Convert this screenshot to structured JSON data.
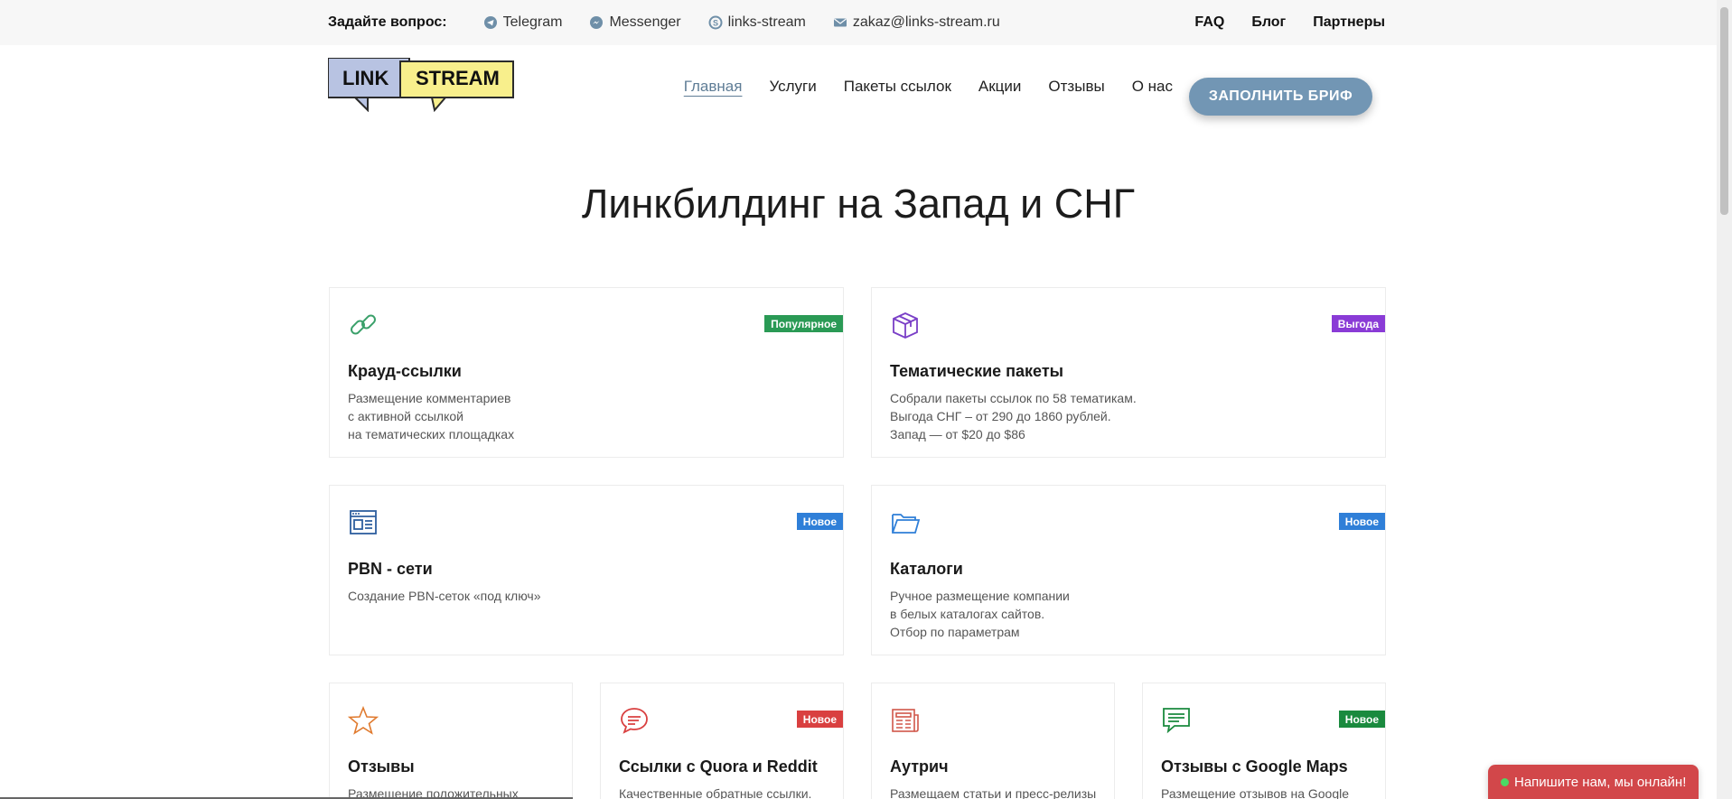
{
  "topbar": {
    "ask_label": "Задайте вопрос:",
    "contacts": [
      {
        "icon": "telegram-icon",
        "label": "Telegram"
      },
      {
        "icon": "messenger-icon",
        "label": "Messenger"
      },
      {
        "icon": "skype-icon",
        "label": "links-stream"
      },
      {
        "icon": "mail-icon",
        "label": "zakaz@links-stream.ru"
      }
    ],
    "links": [
      "FAQ",
      "Блог",
      "Партнеры"
    ]
  },
  "logo": {
    "left": "LINK",
    "right": "STREAM"
  },
  "nav": {
    "items": [
      "Главная",
      "Услуги",
      "Пакеты ссылок",
      "Акции",
      "Отзывы",
      "О нас"
    ],
    "active": "Главная",
    "cta": "ЗАПОЛНИТЬ БРИФ"
  },
  "hero": {
    "title": "Линкбилдинг на Запад и СНГ"
  },
  "cards": [
    {
      "icon": "chain-link-icon",
      "badge": "Популярное",
      "badge_color": "#2a9a55",
      "title": "Крауд-ссылки",
      "desc": [
        "Размещение комментариев",
        "с активной ссылкой",
        "на тематических площадках"
      ]
    },
    {
      "icon": "box-icon",
      "badge": "Выгода",
      "badge_color": "#8a3bd6",
      "title": "Тематические пакеты",
      "desc": [
        "Собрали пакеты ссылок по 58 тематикам.",
        "Выгода СНГ – от 290 до 1860 рублей.",
        "Запад — от $20 до $86"
      ]
    },
    {
      "icon": "website-icon",
      "badge": "Новое",
      "badge_color": "#2f7fd8",
      "title": "PBN - сети",
      "desc": [
        "Создание PBN-сеток «под ключ»"
      ]
    },
    {
      "icon": "folder-icon",
      "badge": "Новое",
      "badge_color": "#2f7fd8",
      "title": "Каталоги",
      "desc": [
        "Ручное размещение компании",
        "в белых каталогах сайтов.",
        "Отбор по параметрам"
      ]
    },
    {
      "icon": "star-icon",
      "badge": "",
      "badge_color": "",
      "title": "Отзывы",
      "desc": [
        "Размещение положительных"
      ]
    },
    {
      "icon": "speech-bubble-icon",
      "badge": "Новое",
      "badge_color": "#d94040",
      "title": "Ссылки с Quora и Reddit",
      "desc": [
        "Качественные обратные ссылки."
      ]
    },
    {
      "icon": "newspaper-icon",
      "badge": "",
      "badge_color": "",
      "title": "Аутрич",
      "desc": [
        "Размещаем статьи и пресс-релизы"
      ]
    },
    {
      "icon": "chat-icon",
      "badge": "Новое",
      "badge_color": "#1a8a3e",
      "title": "Отзывы с Google Maps",
      "desc": [
        "Размещение отзывов на Google"
      ]
    }
  ],
  "chat": {
    "label": "Напишите нам, мы онлайн!"
  }
}
